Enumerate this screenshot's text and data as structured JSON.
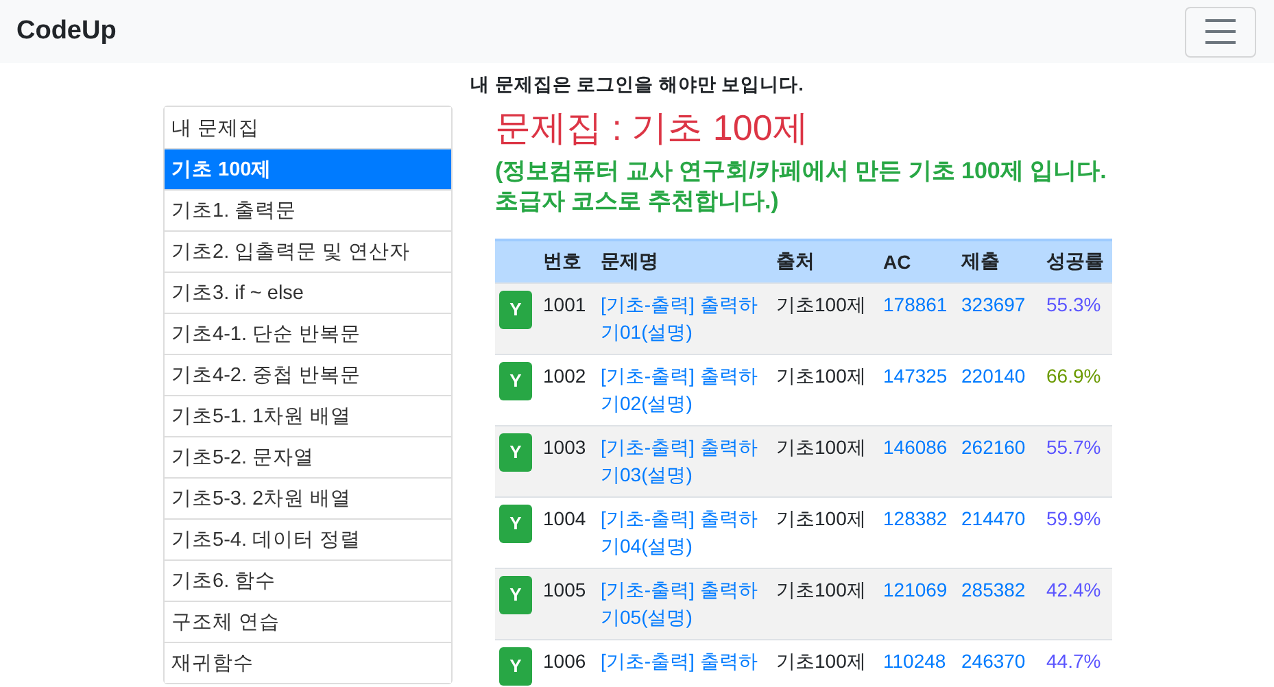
{
  "navbar": {
    "brand": "CodeUp"
  },
  "notice": "내 문제집은 로그인을 해야만 보입니다.",
  "sidebar": {
    "items": [
      {
        "label": "내 문제집",
        "selected": false
      },
      {
        "label": "기초 100제",
        "selected": true
      },
      {
        "label": "기초1. 출력문",
        "selected": false
      },
      {
        "label": "기초2. 입출력문 및 연산자",
        "selected": false
      },
      {
        "label": "기초3. if ~ else",
        "selected": false
      },
      {
        "label": "기초4-1. 단순 반복문",
        "selected": false
      },
      {
        "label": "기초4-2. 중첩 반복문",
        "selected": false
      },
      {
        "label": "기초5-1. 1차원 배열",
        "selected": false
      },
      {
        "label": "기초5-2. 문자열",
        "selected": false
      },
      {
        "label": "기초5-3. 2차원 배열",
        "selected": false
      },
      {
        "label": "기초5-4. 데이터 정렬",
        "selected": false
      },
      {
        "label": "기초6. 함수",
        "selected": false
      },
      {
        "label": "구조체 연습",
        "selected": false
      },
      {
        "label": "재귀함수",
        "selected": false
      }
    ]
  },
  "title": "문제집 : 기초 100제",
  "description": "(정보컴퓨터 교사 연구회/카페에서 만든 기초 100제 입니다. 초급자 코스로 추천합니다.)",
  "table": {
    "columns": [
      "번호",
      "문제명",
      "출처",
      "AC",
      "제출",
      "성공률"
    ],
    "rows": [
      {
        "badge": "Y",
        "number": "1001",
        "title": "[기초-출력] 출력하기01(설명)",
        "source": "기초100제",
        "ac": "178861",
        "submit": "323697",
        "rate": "55.3%",
        "color": "#5b55ff"
      },
      {
        "badge": "Y",
        "number": "1002",
        "title": "[기초-출력] 출력하기02(설명)",
        "source": "기초100제",
        "ac": "147325",
        "submit": "220140",
        "rate": "66.9%",
        "color": "#6b9a00"
      },
      {
        "badge": "Y",
        "number": "1003",
        "title": "[기초-출력] 출력하기03(설명)",
        "source": "기초100제",
        "ac": "146086",
        "submit": "262160",
        "rate": "55.7%",
        "color": "#5b55ff"
      },
      {
        "badge": "Y",
        "number": "1004",
        "title": "[기초-출력] 출력하기04(설명)",
        "source": "기초100제",
        "ac": "128382",
        "submit": "214470",
        "rate": "59.9%",
        "color": "#5b55ff"
      },
      {
        "badge": "Y",
        "number": "1005",
        "title": "[기초-출력] 출력하기05(설명)",
        "source": "기초100제",
        "ac": "121069",
        "submit": "285382",
        "rate": "42.4%",
        "color": "#5b55ff"
      },
      {
        "badge": "Y",
        "number": "1006",
        "title": "[기초-출력] 출력하",
        "source": "기초100제",
        "ac": "110248",
        "submit": "246370",
        "rate": "44.7%",
        "color": "#5b55ff"
      }
    ]
  }
}
